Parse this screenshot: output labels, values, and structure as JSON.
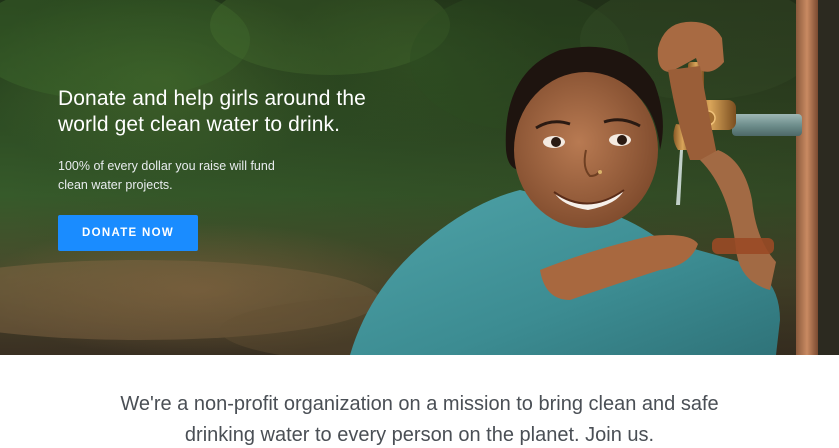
{
  "hero": {
    "heading_line1": "Donate and help girls around the",
    "heading_line2": "world get clean water to drink.",
    "sub_line1": "100% of every dollar you raise will fund",
    "sub_line2": "clean water projects.",
    "donate_label": "DONATE NOW",
    "photo": "girl-drinking-from-water-tap"
  },
  "mission": {
    "line1": "We're a non-profit organization on a mission to bring clean and safe",
    "line2": "drinking water to every person on the planet. Join us."
  },
  "colors": {
    "button": "#1a8cff",
    "mission_text": "#4a4f55",
    "hero_text": "#ffffff"
  }
}
